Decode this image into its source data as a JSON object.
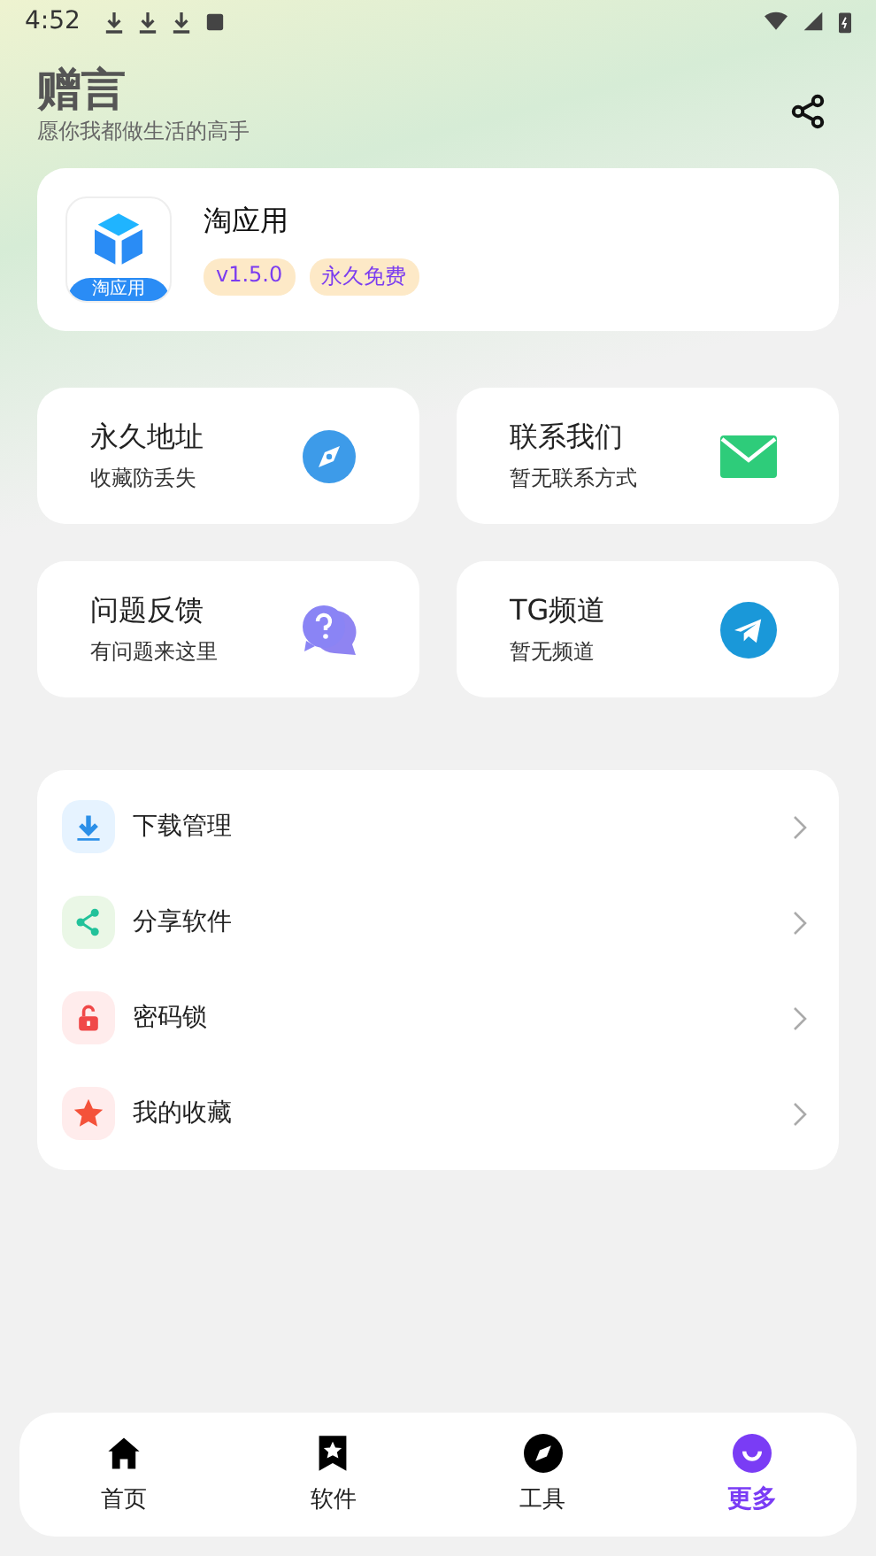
{
  "status_bar": {
    "time": "4:52"
  },
  "header": {
    "title": "赠言",
    "subtitle": "愿你我都做生活的高手"
  },
  "app_card": {
    "logo_text": "淘应用",
    "name": "淘应用",
    "badges": [
      "v1.5.0",
      "永久免费"
    ]
  },
  "tiles": [
    {
      "title": "永久地址",
      "subtitle": "收藏防丢失"
    },
    {
      "title": "联系我们",
      "subtitle": "暂无联系方式"
    },
    {
      "title": "问题反馈",
      "subtitle": "有问题来这里"
    },
    {
      "title": "TG频道",
      "subtitle": "暂无频道"
    }
  ],
  "menu": [
    {
      "label": "下载管理"
    },
    {
      "label": "分享软件"
    },
    {
      "label": "密码锁"
    },
    {
      "label": "我的收藏"
    }
  ],
  "tab_bar": [
    {
      "label": "首页",
      "selected": false
    },
    {
      "label": "软件",
      "selected": false
    },
    {
      "label": "工具",
      "selected": false
    },
    {
      "label": "更多",
      "selected": true
    }
  ]
}
